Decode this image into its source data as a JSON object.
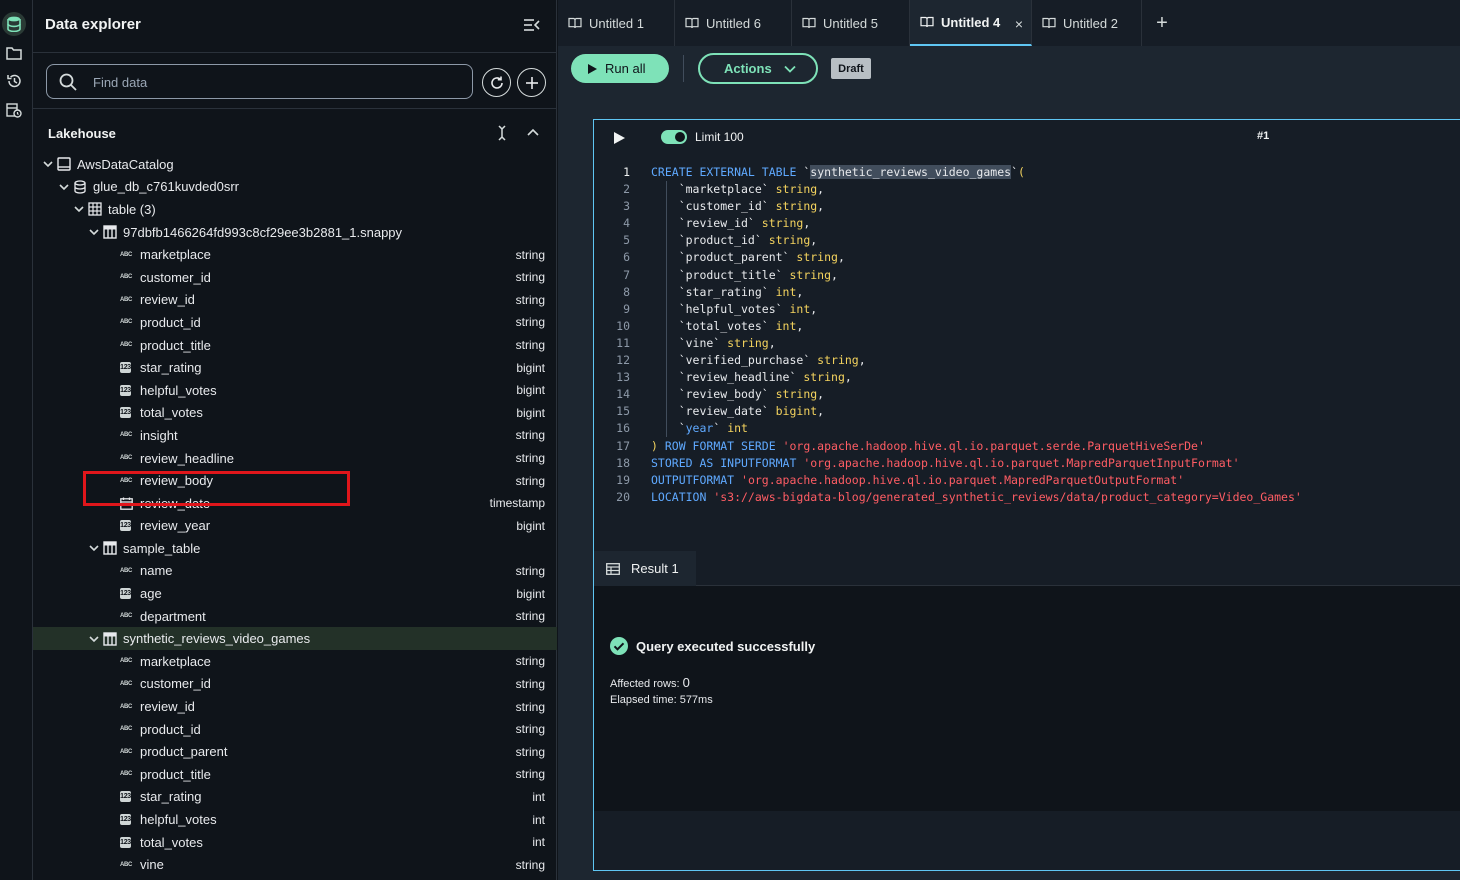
{
  "rail": {
    "items": [
      "database-icon",
      "folder-icon",
      "history-icon",
      "scheduled-icon"
    ]
  },
  "explorer": {
    "title": "Data explorer",
    "search_placeholder": "Find data",
    "section_title": "Lakehouse",
    "tree": {
      "catalog": "AwsDataCatalog",
      "database": "glue_db_c761kuvded0srr",
      "tables_group": "table (3)",
      "tables": [
        {
          "name": "97dbfb1466264fd993c8cf29ee3b2881_1.snappy",
          "columns": [
            {
              "name": "marketplace",
              "type": "string",
              "kind": "abc"
            },
            {
              "name": "customer_id",
              "type": "string",
              "kind": "abc"
            },
            {
              "name": "review_id",
              "type": "string",
              "kind": "abc"
            },
            {
              "name": "product_id",
              "type": "string",
              "kind": "abc"
            },
            {
              "name": "product_title",
              "type": "string",
              "kind": "abc"
            },
            {
              "name": "star_rating",
              "type": "bigint",
              "kind": "num"
            },
            {
              "name": "helpful_votes",
              "type": "bigint",
              "kind": "num"
            },
            {
              "name": "total_votes",
              "type": "bigint",
              "kind": "num"
            },
            {
              "name": "insight",
              "type": "string",
              "kind": "abc"
            },
            {
              "name": "review_headline",
              "type": "string",
              "kind": "abc"
            },
            {
              "name": "review_body",
              "type": "string",
              "kind": "abc"
            },
            {
              "name": "review_date",
              "type": "timestamp",
              "kind": "date"
            },
            {
              "name": "review_year",
              "type": "bigint",
              "kind": "num"
            }
          ]
        },
        {
          "name": "sample_table",
          "columns": [
            {
              "name": "name",
              "type": "string",
              "kind": "abc"
            },
            {
              "name": "age",
              "type": "bigint",
              "kind": "num"
            },
            {
              "name": "department",
              "type": "string",
              "kind": "abc"
            }
          ]
        },
        {
          "name": "synthetic_reviews_video_games",
          "selected": true,
          "columns": [
            {
              "name": "marketplace",
              "type": "string",
              "kind": "abc"
            },
            {
              "name": "customer_id",
              "type": "string",
              "kind": "abc"
            },
            {
              "name": "review_id",
              "type": "string",
              "kind": "abc"
            },
            {
              "name": "product_id",
              "type": "string",
              "kind": "abc"
            },
            {
              "name": "product_parent",
              "type": "string",
              "kind": "abc"
            },
            {
              "name": "product_title",
              "type": "string",
              "kind": "abc"
            },
            {
              "name": "star_rating",
              "type": "int",
              "kind": "num"
            },
            {
              "name": "helpful_votes",
              "type": "int",
              "kind": "num"
            },
            {
              "name": "total_votes",
              "type": "int",
              "kind": "num"
            },
            {
              "name": "vine",
              "type": "string",
              "kind": "abc"
            }
          ]
        }
      ]
    }
  },
  "tabs": [
    {
      "label": "Untitled 1",
      "active": false
    },
    {
      "label": "Untitled 6",
      "active": false
    },
    {
      "label": "Untitled 5",
      "active": false
    },
    {
      "label": "Untitled 4",
      "active": true
    },
    {
      "label": "Untitled 2",
      "active": false
    }
  ],
  "toolbar": {
    "run_all": "Run all",
    "actions": "Actions",
    "draft": "Draft"
  },
  "cell": {
    "limit_label": "Limit 100",
    "limit_on": true,
    "cell_number": "#1",
    "code_lines": [
      [
        [
          "kw",
          "CREATE EXTERNAL TABLE "
        ],
        [
          "",
          "`"
        ],
        [
          "hl",
          "synthetic_reviews_video_games"
        ],
        [
          "",
          "`"
        ],
        [
          "ty",
          "("
        ]
      ],
      [
        [
          "",
          "    `marketplace` "
        ],
        [
          "ty",
          "string"
        ],
        [
          "",
          ","
        ]
      ],
      [
        [
          "",
          "    `customer_id` "
        ],
        [
          "ty",
          "string"
        ],
        [
          "",
          ","
        ]
      ],
      [
        [
          "",
          "    `review_id` "
        ],
        [
          "ty",
          "string"
        ],
        [
          "",
          ","
        ]
      ],
      [
        [
          "",
          "    `product_id` "
        ],
        [
          "ty",
          "string"
        ],
        [
          "",
          ","
        ]
      ],
      [
        [
          "",
          "    `product_parent` "
        ],
        [
          "ty",
          "string"
        ],
        [
          "",
          ","
        ]
      ],
      [
        [
          "",
          "    `product_title` "
        ],
        [
          "ty",
          "string"
        ],
        [
          "",
          ","
        ]
      ],
      [
        [
          "",
          "    `star_rating` "
        ],
        [
          "ty",
          "int"
        ],
        [
          "",
          ","
        ]
      ],
      [
        [
          "",
          "    `helpful_votes` "
        ],
        [
          "ty",
          "int"
        ],
        [
          "",
          ","
        ]
      ],
      [
        [
          "",
          "    `total_votes` "
        ],
        [
          "ty",
          "int"
        ],
        [
          "",
          ","
        ]
      ],
      [
        [
          "",
          "    `vine` "
        ],
        [
          "ty",
          "string"
        ],
        [
          "",
          ","
        ]
      ],
      [
        [
          "",
          "    `verified_purchase` "
        ],
        [
          "ty",
          "string"
        ],
        [
          "",
          ","
        ]
      ],
      [
        [
          "",
          "    `review_headline` "
        ],
        [
          "ty",
          "string"
        ],
        [
          "",
          ","
        ]
      ],
      [
        [
          "",
          "    `review_body` "
        ],
        [
          "ty",
          "string"
        ],
        [
          "",
          ","
        ]
      ],
      [
        [
          "",
          "    `review_date` "
        ],
        [
          "ty",
          "bigint"
        ],
        [
          "",
          ","
        ]
      ],
      [
        [
          "",
          "    `"
        ],
        [
          "kw",
          "year"
        ],
        [
          "",
          "` "
        ],
        [
          "ty",
          "int"
        ]
      ],
      [
        [
          "ty",
          ")"
        ],
        [
          "kw",
          " ROW FORMAT SERDE "
        ],
        [
          "str",
          "'org.apache.hadoop.hive.ql.io.parquet.serde.ParquetHiveSerDe'"
        ]
      ],
      [
        [
          "kw",
          "STORED AS INPUTFORMAT "
        ],
        [
          "str",
          "'org.apache.hadoop.hive.ql.io.parquet.MapredParquetInputFormat'"
        ]
      ],
      [
        [
          "kw",
          "OUTPUTFORMAT "
        ],
        [
          "str",
          "'org.apache.hadoop.hive.ql.io.parquet.MapredParquetOutputFormat'"
        ]
      ],
      [
        [
          "kw",
          "LOCATION "
        ],
        [
          "str",
          "'s3://aws-bigdata-blog/generated_synthetic_reviews/data/product_category=Video_Games'"
        ]
      ]
    ]
  },
  "result": {
    "tab_label": "Result 1",
    "status": "Query executed successfully",
    "affected_label": "Affected rows: ",
    "affected_value": "0",
    "elapsed": "Elapsed time: 577ms"
  },
  "colors": {
    "accent_green": "#7ee2b8",
    "focus_blue": "#5fc6f3",
    "highlight_red": "#e0161b",
    "keyword_blue": "#5fa9ff",
    "type_yellow": "#f4d35e",
    "string_red": "#ff5d64"
  }
}
